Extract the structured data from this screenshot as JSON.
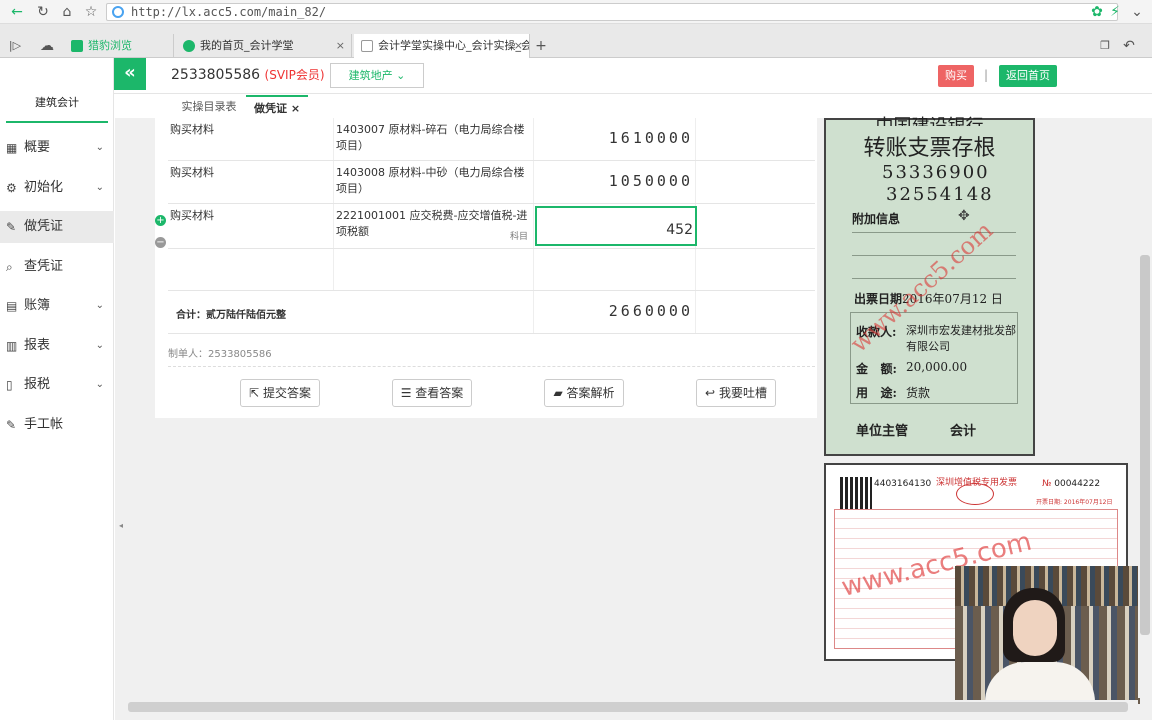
{
  "browser": {
    "url": "http://lx.acc5.com/main_82/",
    "tabs": [
      {
        "label": "猎豹浏览"
      },
      {
        "label": "我的首页_会计学堂"
      },
      {
        "label": "会计学堂实操中心_会计实操_会"
      }
    ]
  },
  "header": {
    "user_id": "2533805586",
    "vip_label": "(SVIP会员)",
    "industry": "建筑地产",
    "buy_label": "购买",
    "separator": "|",
    "home_label": "返回首页"
  },
  "sidebar": {
    "brand": "建筑会计",
    "items": [
      {
        "label": "概要",
        "icon": "grid-icon",
        "has_chevron": true
      },
      {
        "label": "初始化",
        "icon": "gear-icon",
        "has_chevron": true
      },
      {
        "label": "做凭证",
        "icon": "pen-icon",
        "has_chevron": false,
        "active": true
      },
      {
        "label": "查凭证",
        "icon": "search-icon",
        "has_chevron": false
      },
      {
        "label": "账簿",
        "icon": "book-icon",
        "has_chevron": true
      },
      {
        "label": "报表",
        "icon": "report-icon",
        "has_chevron": true
      },
      {
        "label": "报税",
        "icon": "file-icon",
        "has_chevron": true
      },
      {
        "label": "手工帐",
        "icon": "pen-icon",
        "has_chevron": false
      }
    ]
  },
  "page_tabs": [
    {
      "label": "实操目录表"
    },
    {
      "label": "做凭证",
      "close": "×"
    }
  ],
  "voucher": {
    "rows": [
      {
        "summary": "购买材料",
        "account": "1403007 原材料-碎石（电力局综合楼项目）",
        "debit": "1610000"
      },
      {
        "summary": "购买材料",
        "account": "1403008 原材料-中砂（电力局综合楼项目）",
        "debit": "1050000"
      },
      {
        "summary": "购买材料",
        "account": "2221001001 应交税费-应交增值税-进项税额",
        "debit": "452"
      }
    ],
    "kemu_hint": "科目",
    "total_label": "合计：贰万陆仟陆佰元整",
    "total_amount": "2660000",
    "maker": "制单人：2533805586",
    "actions": [
      {
        "label": "提交答案",
        "icon": "external-link-icon"
      },
      {
        "label": "查看答案",
        "icon": "database-icon"
      },
      {
        "label": "答案解析",
        "icon": "folder-open-icon"
      },
      {
        "label": "我要吐槽",
        "icon": "reply-icon"
      }
    ]
  },
  "check_stub": {
    "bank_title": "中国建设银行",
    "title": "转账支票存根",
    "code1": "53336900",
    "code2": "32554148",
    "extra_label": "附加信息",
    "date_label": "出票日期",
    "date_value": "2016年07月12 日",
    "payee_label": "收款人:",
    "payee_value": "深圳市宏发建材批发部有限公司",
    "amount_label": "金   额:",
    "amount_value": "20,000.00",
    "use_label": "用   途:",
    "use_value": "货款",
    "footer_left": "单位主管",
    "footer_right": "会计",
    "watermark": "www.acc5.com"
  },
  "invoice": {
    "code": "4403164130",
    "title": "深圳增值税专用发票",
    "no_label": "№",
    "number": "00044222",
    "date": "开票日期: 2016年07月12日",
    "watermark": "www.acc5.com"
  },
  "colors": {
    "accent": "#1cb76a",
    "danger": "#ee6464"
  }
}
